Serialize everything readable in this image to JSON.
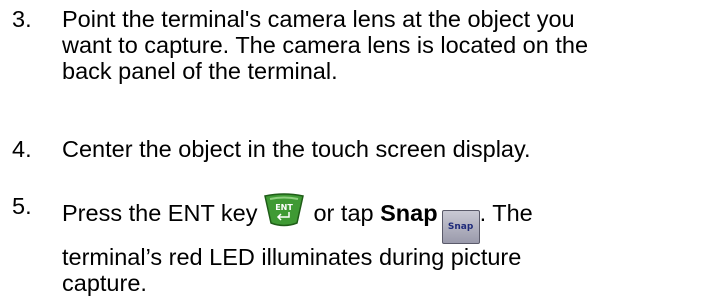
{
  "steps": [
    {
      "number": "3.",
      "lines": [
        "Point the terminal's camera lens at the object you",
        "want to capture. The camera lens is located on the",
        "back panel of the terminal."
      ]
    },
    {
      "number": "4.",
      "lines": [
        "Center the object in the touch screen display."
      ]
    },
    {
      "number": "5.",
      "line1_prefix": "Press the ENT key",
      "line1_middle": "or tap",
      "line1_bold": "Snap",
      "line1_suffix": ". The",
      "lines_after": [
        "terminal’s red LED illuminates during picture",
        "capture."
      ],
      "ent_key_label": "ENT",
      "snap_button_label": "Snap"
    }
  ],
  "icons": {
    "ent_key": "ent-key-icon",
    "snap_button": "snap-button-icon"
  },
  "colors": {
    "ent_key_green": "#3f9a34",
    "snap_button_text": "#1e2a7a"
  }
}
